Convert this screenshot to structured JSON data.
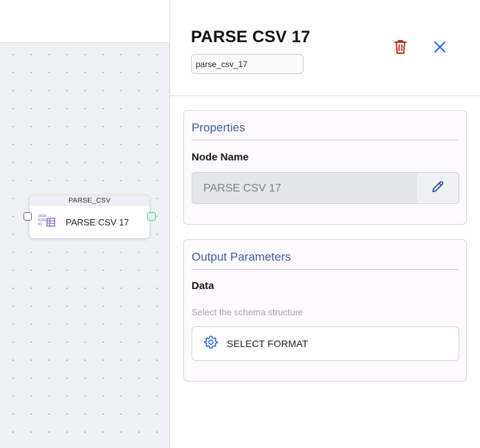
{
  "canvas": {
    "node": {
      "type_label": "PARSE_CSV",
      "name": "PARSE CSV 17",
      "icon": "binary-table-icon"
    }
  },
  "panel": {
    "title": "PARSE CSV 17",
    "node_id": "parse_csv_17",
    "delete_icon": "trash-icon",
    "close_icon": "close-icon",
    "properties": {
      "heading": "Properties",
      "node_name_label": "Node Name",
      "node_name_value": "PARSE CSV 17",
      "edit_icon": "pencil-icon"
    },
    "output": {
      "heading": "Output Parameters",
      "data_label": "Data",
      "hint": "Select the schema structure",
      "select_format_label": "SELECT FORMAT",
      "select_format_icon": "gear-icon"
    }
  },
  "colors": {
    "accent_blue": "#2563eb",
    "heading_blue": "#3a5fa0",
    "delete_red": "#c62828",
    "port_green": "#3ec98e",
    "node_icon_purple": "#7b4fbf"
  }
}
